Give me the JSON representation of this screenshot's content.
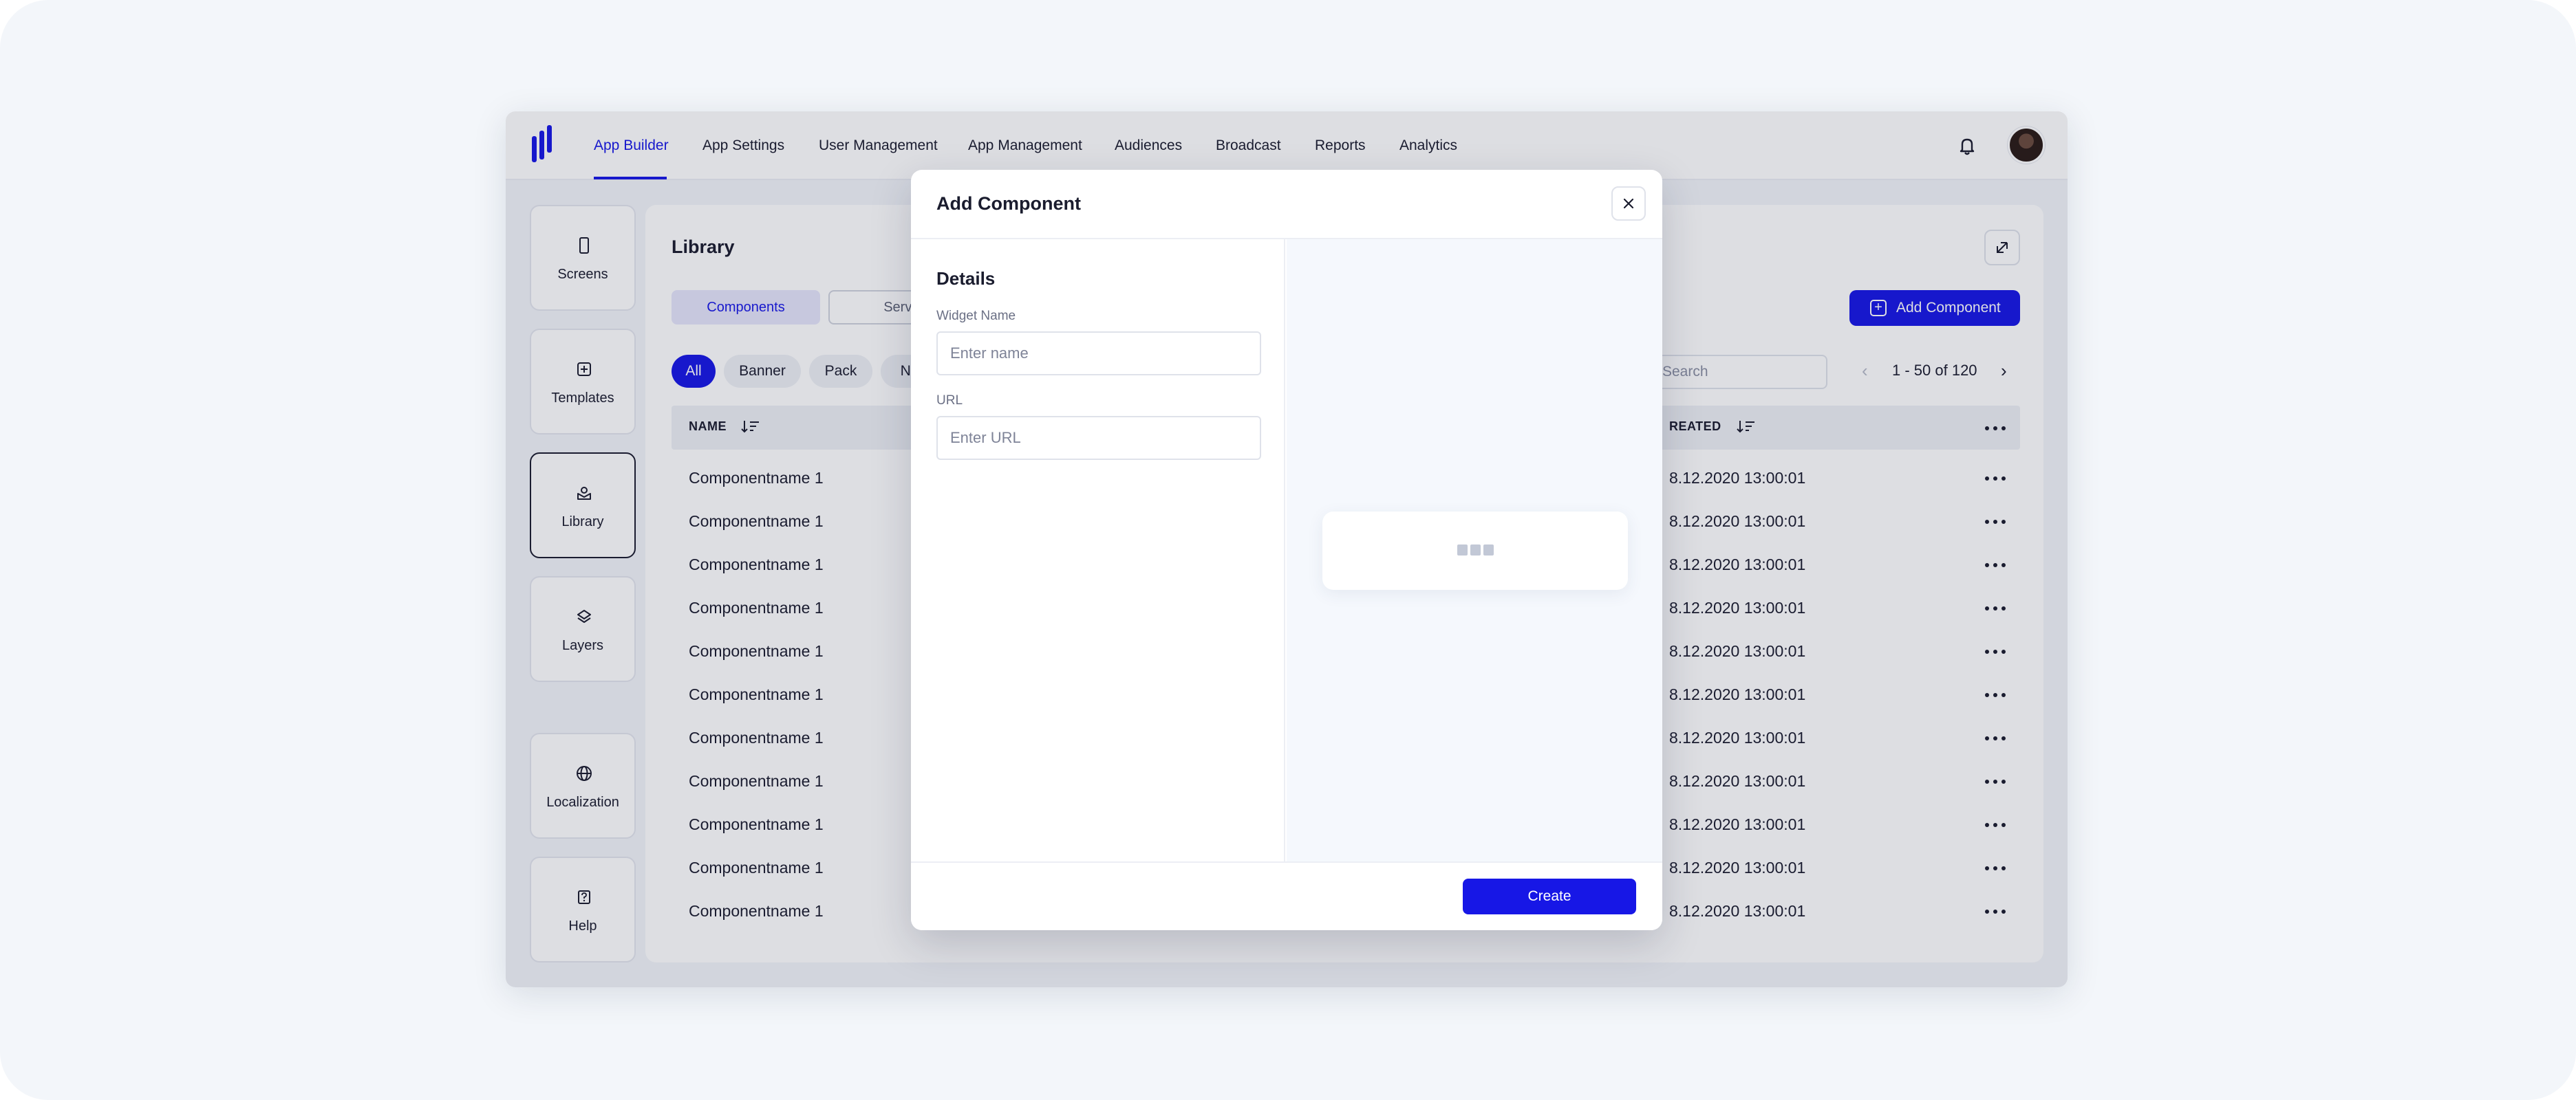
{
  "nav": {
    "items": [
      "App Builder",
      "App Settings",
      "User Management",
      "App Management",
      "Audiences",
      "Broadcast",
      "Reports",
      "Analytics"
    ],
    "active": "App Builder",
    "icons": [
      "bell-icon",
      "avatar"
    ]
  },
  "sidebar": {
    "items": [
      {
        "label": "Screens",
        "icon": "phone-icon"
      },
      {
        "label": "Templates",
        "icon": "plus-square-icon"
      },
      {
        "label": "Library",
        "icon": "library-icon",
        "active": true
      },
      {
        "label": "Layers",
        "icon": "layers-icon"
      },
      {
        "label": "Localization",
        "icon": "globe-icon"
      },
      {
        "label": "Help",
        "icon": "help-icon"
      }
    ]
  },
  "library": {
    "title": "Library",
    "tabs": [
      "Components",
      "Servic"
    ],
    "add_button": "Add Component",
    "filters": [
      "All",
      "Banner",
      "Pack",
      "Ne"
    ],
    "search_placeholder": "Search",
    "pagination": "1 - 50 of 120",
    "columns": [
      "NAME",
      "REATED"
    ],
    "rows": [
      {
        "name": "Componentname 1",
        "created": "8.12.2020 13:00:01"
      },
      {
        "name": "Componentname 1",
        "created": "8.12.2020 13:00:01"
      },
      {
        "name": "Componentname 1",
        "created": "8.12.2020 13:00:01"
      },
      {
        "name": "Componentname 1",
        "created": "8.12.2020 13:00:01"
      },
      {
        "name": "Componentname 1",
        "created": "8.12.2020 13:00:01"
      },
      {
        "name": "Componentname 1",
        "created": "8.12.2020 13:00:01"
      },
      {
        "name": "Componentname 1",
        "created": "8.12.2020 13:00:01"
      },
      {
        "name": "Componentname 1",
        "created": "8.12.2020 13:00:01"
      },
      {
        "name": "Componentname 1",
        "created": "8.12.2020 13:00:01"
      },
      {
        "name": "Componentname 1",
        "created": "8.12.2020 13:00:01"
      },
      {
        "name": "Componentname 1",
        "created": "8.12.2020 13:00:01"
      }
    ]
  },
  "modal": {
    "title": "Add Component",
    "section": "Details",
    "widget_name_label": "Widget Name",
    "widget_name_placeholder": "Enter name",
    "url_label": "URL",
    "url_placeholder": "Enter URL",
    "create_button": "Create"
  },
  "colors": {
    "accent": "#1717e6",
    "text": "#1a1c2e",
    "background": "#f3f6fa"
  }
}
